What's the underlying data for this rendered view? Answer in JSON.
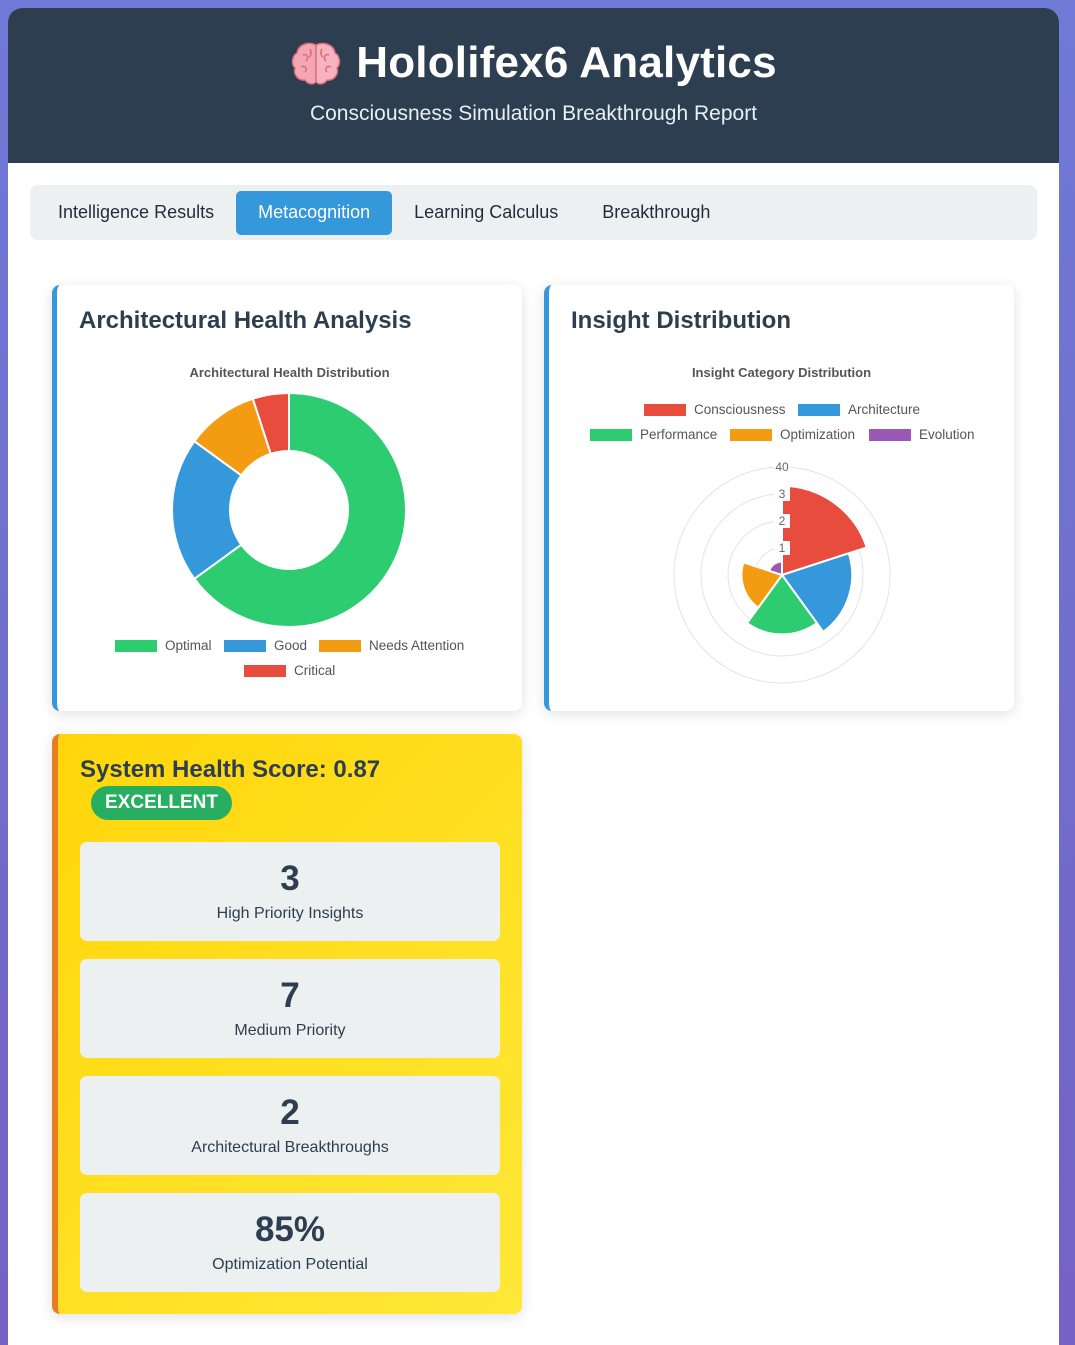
{
  "header": {
    "title": "Hololifex6 Analytics",
    "subtitle": "Consciousness Simulation Breakthrough Report",
    "icon": "brain-icon"
  },
  "tabs": [
    {
      "label": "Intelligence Results",
      "active": false
    },
    {
      "label": "Metacognition",
      "active": true
    },
    {
      "label": "Learning Calculus",
      "active": false
    },
    {
      "label": "Breakthrough",
      "active": false
    }
  ],
  "architecture_card": {
    "heading": "Architectural Health Analysis"
  },
  "insight_card": {
    "heading": "Insight Distribution"
  },
  "chart_data": [
    {
      "type": "pie",
      "variant": "doughnut",
      "title": "Architectural Health Distribution",
      "categories": [
        "Optimal",
        "Good",
        "Needs Attention",
        "Critical"
      ],
      "values": [
        65,
        20,
        10,
        5
      ],
      "colors": [
        "#2ecc71",
        "#3498db",
        "#f39c12",
        "#e74c3c"
      ],
      "legend_position": "bottom"
    },
    {
      "type": "polarArea",
      "title": "Insight Category Distribution",
      "categories": [
        "Consciousness",
        "Architecture",
        "Performance",
        "Optimization",
        "Evolution"
      ],
      "values": [
        33,
        26,
        22,
        15,
        5
      ],
      "colors": [
        "#e74c3c",
        "#3498db",
        "#2ecc71",
        "#f39c12",
        "#9b59b6"
      ],
      "rlim": [
        0,
        40
      ],
      "r_ticks": [
        "1",
        "2",
        "3",
        "40"
      ],
      "legend_position": "top"
    }
  ],
  "health": {
    "title": "System Health Score: 0.87",
    "badge": "EXCELLENT",
    "metrics": [
      {
        "value": "3",
        "label": "High Priority Insights"
      },
      {
        "value": "7",
        "label": "Medium Priority"
      },
      {
        "value": "2",
        "label": "Architectural Breakthroughs"
      },
      {
        "value": "85%",
        "label": "Optimization Potential"
      }
    ]
  }
}
